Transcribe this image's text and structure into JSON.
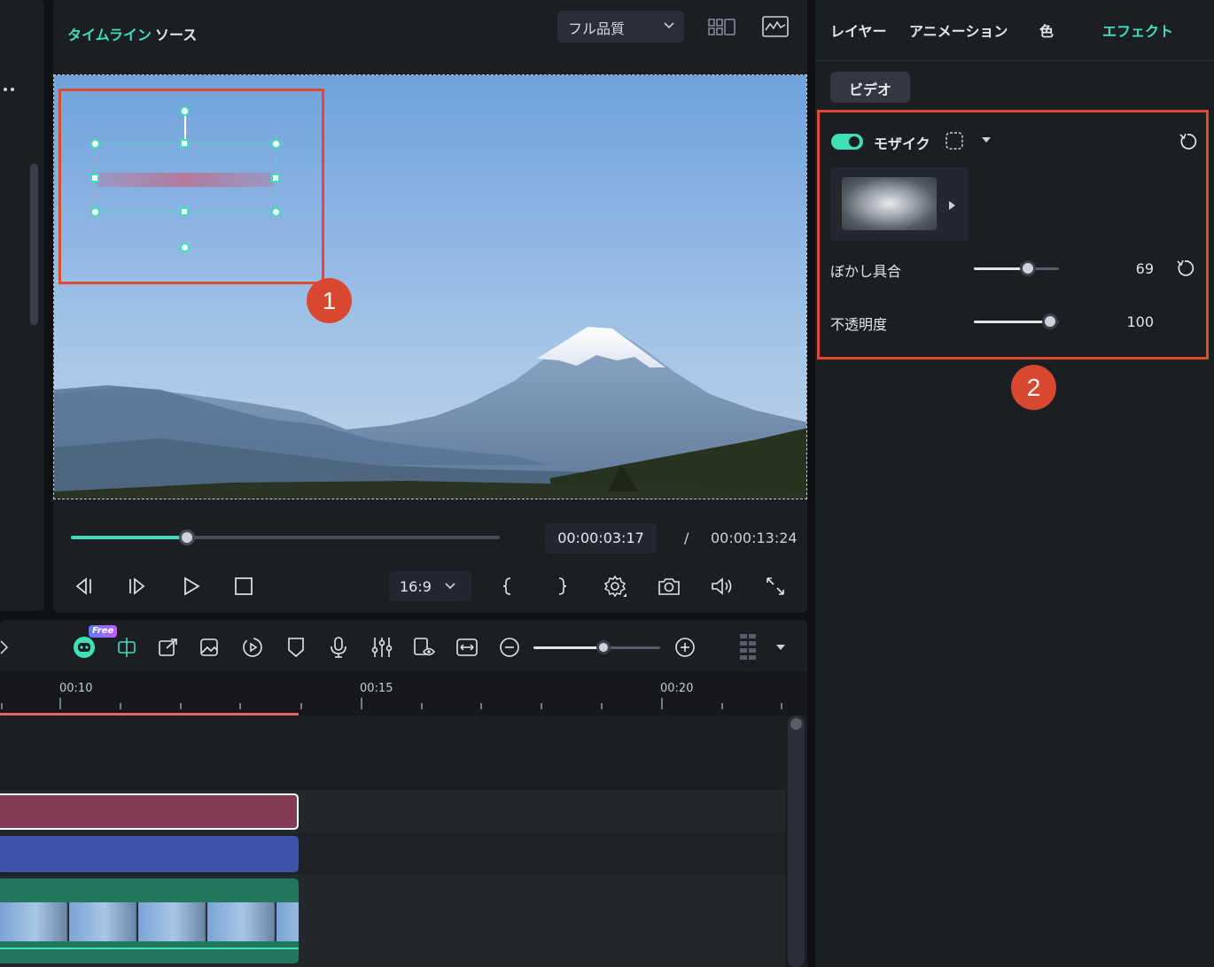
{
  "player": {
    "tabs": [
      "タイムライン",
      "ソース"
    ],
    "quality": "フル品質",
    "time_current": "00:00:03:17",
    "time_separator": "/",
    "time_total": "00:00:13:24",
    "aspect_ratio": "16:9",
    "progress": 0.27
  },
  "right_panel": {
    "tabs": [
      "レイヤー",
      "アニメーション",
      "色",
      "エフェクト"
    ],
    "active_tab": "エフェクト",
    "sub_tab": "ビデオ",
    "effect": {
      "name": "モザイク",
      "enabled": true,
      "params": [
        {
          "label": "ぼかし具合",
          "value": "69",
          "level": 0.64
        },
        {
          "label": "不透明度",
          "value": "100",
          "level": 0.9
        }
      ]
    }
  },
  "annotations": {
    "badge1": "1",
    "badge2": "2"
  },
  "timeline": {
    "free_badge": "Free",
    "ruler": [
      "00:10",
      "00:15",
      "00:20"
    ],
    "zoom_level": 0.55
  },
  "colors": {
    "accent": "#3fe0b5",
    "highlight": "#e04a33",
    "clip_title": "#823b53",
    "clip_effect": "#3e53a8",
    "clip_audio": "#22785f"
  }
}
